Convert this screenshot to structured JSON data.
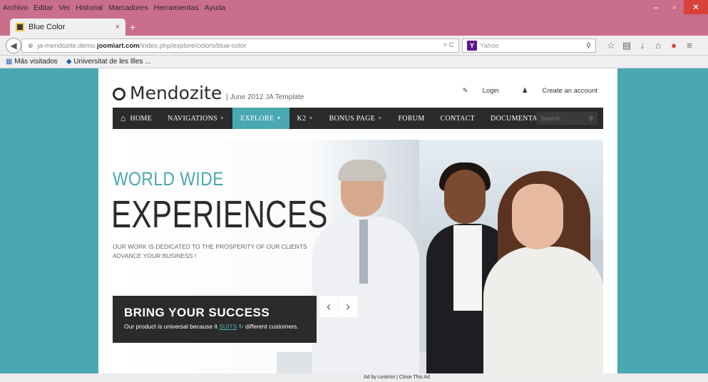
{
  "menubar": {
    "items": [
      "Archivo",
      "Editar",
      "Ver",
      "Historial",
      "Marcadores",
      "Herramientas",
      "Ayuda"
    ]
  },
  "window": {
    "minimize": "–",
    "maximize": "▫",
    "close": "✕"
  },
  "tab": {
    "title": "Blue Color",
    "close": "×",
    "new": "+"
  },
  "nav": {
    "url_prefix": "ja-mendozite.demo.",
    "url_domain": "joomlart.com",
    "url_path": "/index.php/explore/colors/blue-color",
    "search_placeholder": "Yahoo",
    "search_engine_icon": "Y"
  },
  "bookmarks": [
    "Más visitados",
    "Universitat de les Illes ..."
  ],
  "site": {
    "name": "Mendozite",
    "tagline": "| June 2012  JA Template",
    "login": "Login",
    "create_account": "Create an account",
    "menu": [
      "HOME",
      "NAVIGATIONS",
      "EXPLORE",
      "K2",
      "BONUS PAGE",
      "FORUM",
      "CONTACT",
      "DOCUMENTATION"
    ],
    "active_menu": "EXPLORE",
    "search_placeholder": "Search..."
  },
  "hero": {
    "kicker": "WORLD WIDE",
    "headline": "EXPERIENCES",
    "sub_line1": "OUR WORK IS DEDICATED TO THE PROSPERITY OF OUR CLIENTS",
    "sub_line2": "ADVANCE YOUR BUSINESS !",
    "box_title": "BRING YOUR SUCCESS",
    "box_text_pre": "Our product is universal because it",
    "box_link": "SUITS",
    "box_text_post": "different customers.",
    "prev": "‹",
    "next": "›"
  },
  "ad": "Ad by costmin | Close This Ad",
  "colors": {
    "accent": "#4aa8b3",
    "dark": "#2b2b2b",
    "chrome": "#c96e8b"
  }
}
